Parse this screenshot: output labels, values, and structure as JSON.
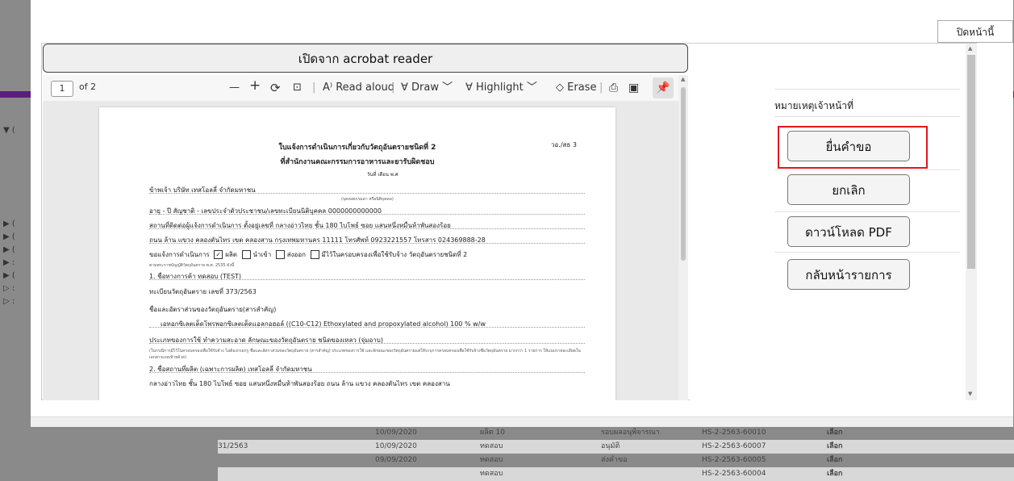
{
  "modal": {
    "close_label": "ปิดหน้านี้",
    "open_acrobat_label": "เปิดจาก acrobat reader"
  },
  "pdf_toolbar": {
    "page_current": "1",
    "page_total": "of 2",
    "zoom_out": "—",
    "zoom_in": "+",
    "read_aloud": "Read aloud",
    "draw": "Draw",
    "highlight": "Highlight",
    "erase": "Erase"
  },
  "document": {
    "title": "ใบแจ้งการดำเนินการเกี่ยวกับวัตถุอันตรายชนิดที่ 2",
    "subtitle": "ที่สำนักงานคณะกรรมการอาหารและยารับผิดชอบ",
    "form_no": "วอ./สธ 3",
    "date_line": "วันที่                    เดือน                        พ.ศ",
    "applicant": "ข้าพเจ้า  บริษัท เทสโอลลี่ จำกัดมหาชน",
    "applicant_note": "(บุคคลธรรมดา หรือนิติบุคคล)",
    "age_line": "อายุ        -        ปี  สัญชาติ        -        เลขประจำตัวประชาชน/เลขทะเบียนนิติบุคคล                0000000000000",
    "address_line": "สถานที่ติดต่อผู้แจ้งการดำเนินการ ตั้งอยู่เลขที่    กลางอ่าวไทย ชั้น 180 ไบโพธ์ ซอย แสนหนึ่งหมื่นห้าพันสองร้อย",
    "address_line2": "ถนน ล้าน แขวง คลองตันไทร เขต คลองสาน กรุงเทพมหานคร 11111 โทรศัพท์ 0923221557 โทรสาร 024369888-28",
    "operation_label": "ขอแจ้งการดำเนินการ",
    "opt_produce": "ผลิต",
    "opt_import": "นำเข้า",
    "opt_export": "ส่งออก",
    "opt_other": "มีไว้ในครอบครองเพื่อใช้รับจ้าง วัตถุอันตรายชนิดที่ 2",
    "law_ref": "ตามพระราชบัญญัติวัตถุอันตราย พ.ศ. 2535 ดังนี้",
    "trade_name": "1. ชื่อทางการค้า    ทดสอบ (TEST)",
    "reg_no": "ทะเบียนวัตถุอันตราย เลขที่    373/2563",
    "ingredient_label": "ชื่อและอัตราส่วนของวัตถุอันตราย(สารสำคัญ)",
    "ingredient": "เอทอกซิเลตเต็ดโพรพอกซิเลตเต็ดแอลกอฮอล์ ((C10-C12) Ethoxylated and propoxylated alcohol) 100 % w/w",
    "usage_line": "ประเภทของการใช้              ทำความสะอาด                 ลักษณะของวัตถุอันตราย          ชนิดของเหลว (จุ่มอาบ)",
    "usage_note": "(ในกรณีการมีไว้ในครอบครองเพื่อใช้รับจ้าง ไม่ต้องกรอกรู ชื่อและอัตราส่วนของวัตถุอันตราย (สารสำคัญ) ประเภทของการใช้ และลักษณะของวัตถุอันตรายแต่ให้ระบุการครอบครองเพื่อใช้รับจ้างชื่อวัตถุอันตราย มากกว่า 1 รายการ ให้แนบรายละเอียดในเอกสารแนบท้ายด้วย)",
    "producer_line": "2. ชื่อสถานที่ผลิต (เฉพาะการผลิต)      เทสโอลลี่ จำกัดมหาชน",
    "producer_address": "กลางอ่าวไทย ชั้น 180 ไบโพธ์ ซอย แสนหนึ่งหมื่นห้าพันสองร้อย ถนน ล้าน แขวง คลองตันไทร เขต คลองสาน"
  },
  "side_panel": {
    "note_label": "หมายเหตุเจ้าหน้าที่",
    "submit_label": "ยื่นคำขอ",
    "cancel_label": "ยกเลิก",
    "download_label": "ดาวน์โหลด PDF",
    "back_label": "กลับหน้ารายการ"
  },
  "background_table": {
    "rows": [
      {
        "ref": "",
        "date": "10/09/2020",
        "name": "ผลิต 10",
        "status": "รอบผลอนุพิจารณา",
        "code": "HS-2-2563-60010",
        "action": "เลือก"
      },
      {
        "ref": "31/2563",
        "date": "10/09/2020",
        "name": "ทดสอบ",
        "status": "อนุมัติ",
        "code": "HS-2-2563-60007",
        "action": "เลือก"
      },
      {
        "ref": "",
        "date": "09/09/2020",
        "name": "ทดสอบ",
        "status": "ส่งคำขอ",
        "code": "HS-2-2563-60005",
        "action": "เลือก"
      },
      {
        "ref": "",
        "date": "",
        "name": "ทดสอบ",
        "status": "",
        "code": "HS-2-2563-60004",
        "action": "เลือก"
      }
    ]
  }
}
